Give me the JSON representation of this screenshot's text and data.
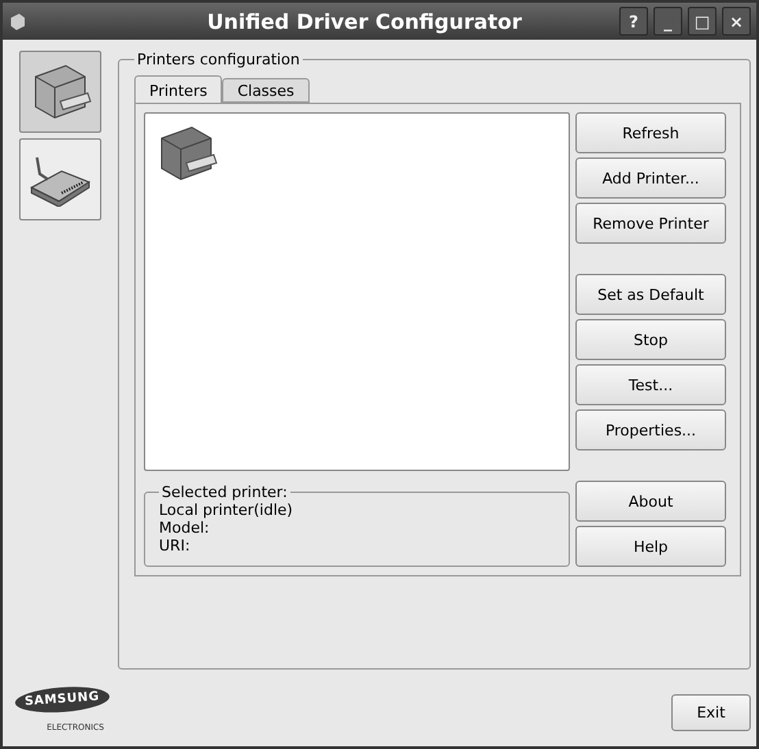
{
  "window": {
    "title": "Unified Driver Configurator",
    "controls": [
      "?",
      "_",
      "□",
      "×"
    ]
  },
  "sidebar": {
    "items": [
      {
        "kind": "printer",
        "selected": true
      },
      {
        "kind": "port",
        "selected": false
      }
    ]
  },
  "group": {
    "title": "Printers configuration"
  },
  "tabs": [
    {
      "label": "Printers",
      "selected": true
    },
    {
      "label": "Classes",
      "selected": false
    }
  ],
  "printers": [
    {
      "kind": "printer",
      "selected": false
    }
  ],
  "button_groups": [
    [
      "Refresh",
      "Add Printer...",
      "Remove Printer"
    ],
    [
      "Set as Default",
      "Stop",
      "Test...",
      "Properties..."
    ],
    [
      "About",
      "Help"
    ]
  ],
  "selected_printer": {
    "title": "Selected printer:",
    "lines": [
      "Local printer(idle)",
      "Model:",
      "URI:"
    ]
  },
  "logo": {
    "name": "SAMSUNG",
    "subtitle": "ELECTRONICS"
  },
  "exit_button": "Exit"
}
